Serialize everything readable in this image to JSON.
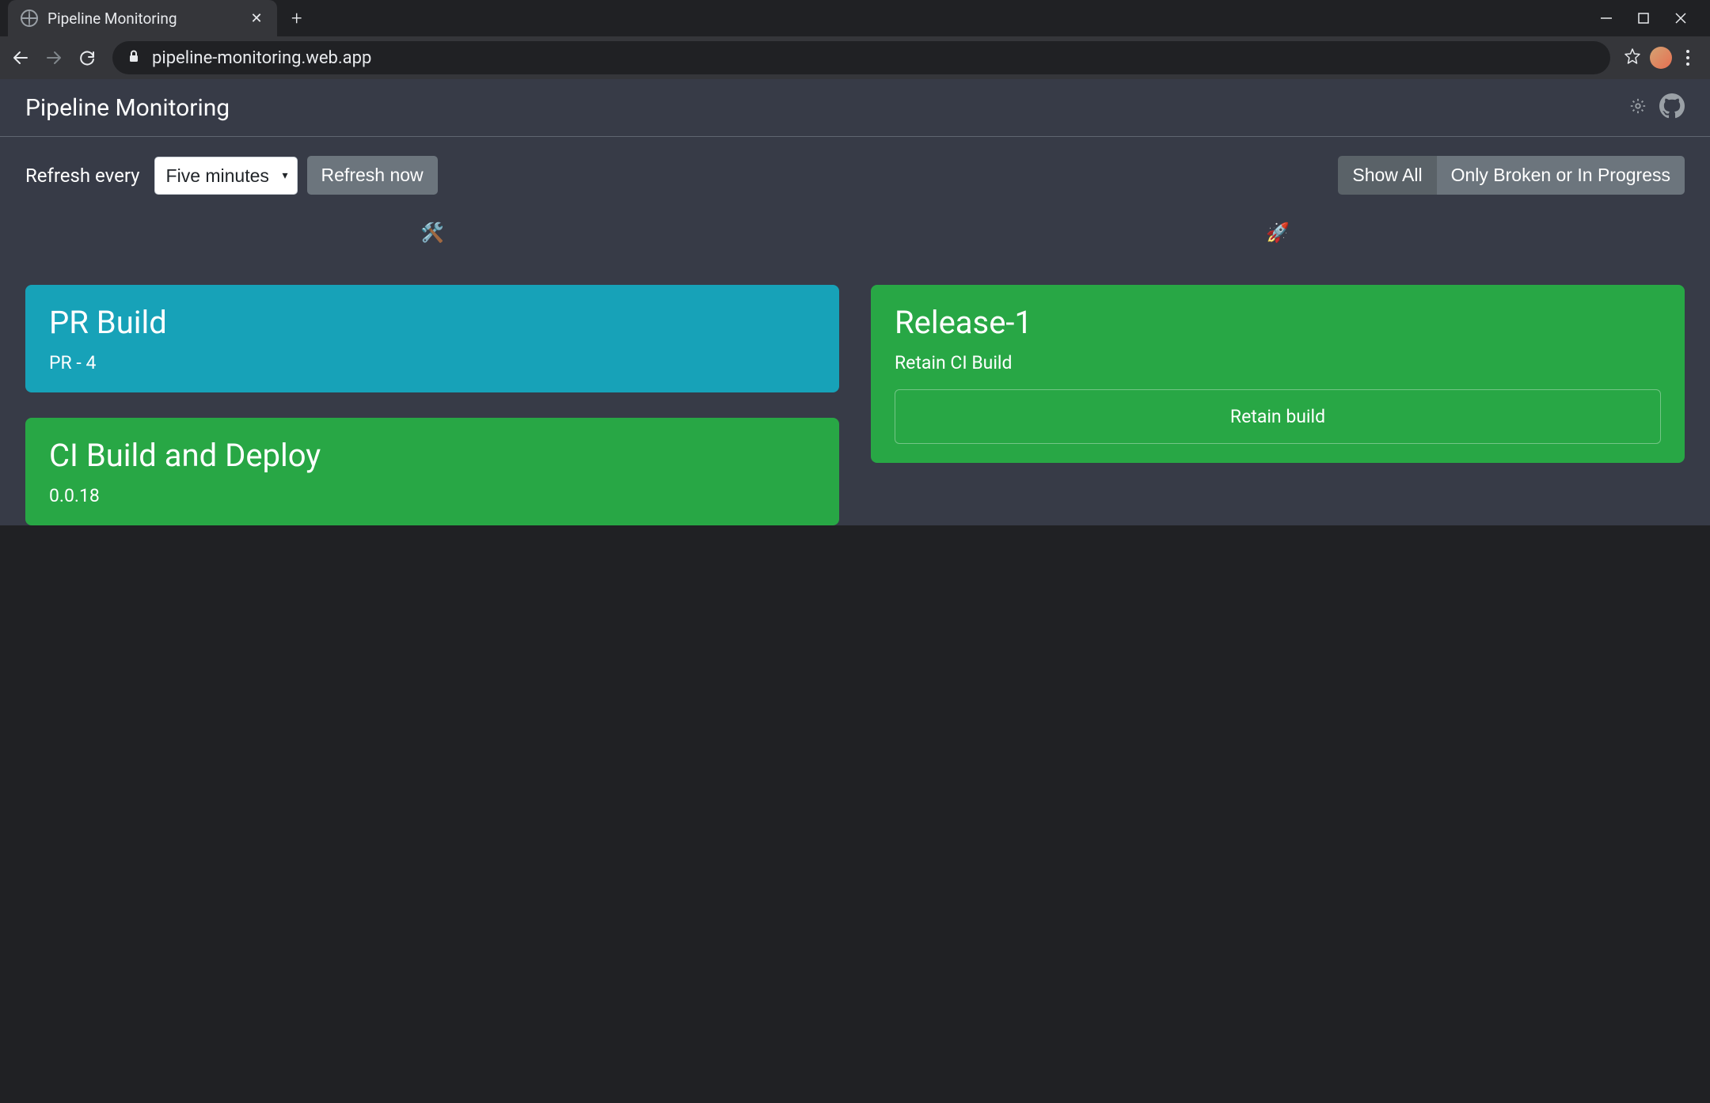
{
  "browser": {
    "tab_title": "Pipeline Monitoring",
    "url": "pipeline-monitoring.web.app"
  },
  "header": {
    "title": "Pipeline Monitoring"
  },
  "toolbar": {
    "refresh_label": "Refresh every",
    "refresh_selected": "Five minutes",
    "refresh_now": "Refresh now",
    "show_all": "Show All",
    "only_broken": "Only Broken or In Progress"
  },
  "columns": {
    "build": {
      "icon": "🛠️",
      "cards": [
        {
          "title": "PR Build",
          "subtitle": "PR - 4",
          "status": "blue"
        },
        {
          "title": "CI Build and Deploy",
          "subtitle": "0.0.18",
          "status": "green"
        }
      ]
    },
    "release": {
      "icon": "🚀",
      "cards": [
        {
          "title": "Release-1",
          "subtitle": "Retain CI Build",
          "status": "green",
          "box": "Retain build"
        }
      ]
    }
  }
}
